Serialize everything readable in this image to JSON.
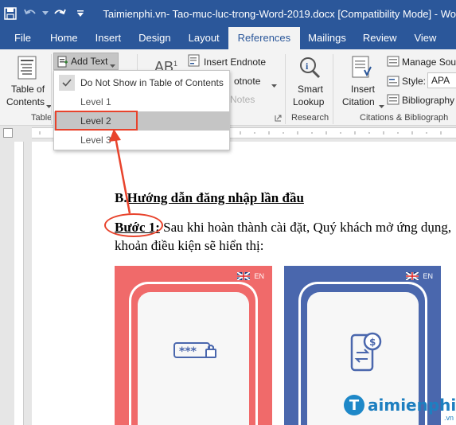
{
  "titlebar": {
    "title": "Taimienphi.vn- Tao-muc-luc-trong-Word-2019.docx [Compatibility Mode] - Wo"
  },
  "tabs": [
    "File",
    "Home",
    "Insert",
    "Design",
    "Layout",
    "References",
    "Mailings",
    "Review",
    "View"
  ],
  "active_tab": "References",
  "ribbon": {
    "toc_label1": "Table of",
    "toc_label2": "Contents",
    "toc_group": "Table",
    "add_text": "Add Text",
    "insert_endnote": "Insert Endnote",
    "next_footnote": "otnote",
    "show_notes": "Notes",
    "smart_lookup1": "Smart",
    "smart_lookup2": "Lookup",
    "research_group": "Research",
    "insert_citation1": "Insert",
    "insert_citation2": "Citation",
    "manage_sources": "Manage Sour",
    "style_label": "Style:",
    "style_value": "APA",
    "bibliography": "Bibliography",
    "citations_group": "Citations & Bibliograph"
  },
  "dropdown": {
    "items": [
      "Do Not Show in Table of Contents",
      "Level 1",
      "Level 2",
      "Level 3"
    ],
    "checked_index": 0,
    "highlighted_index": 2
  },
  "document": {
    "heading_prefix": "B.",
    "heading_rest": "Hướng dẫn đăng nhập lần đầu",
    "step_label": "Bước 1:",
    "step_text": " Sau khi hoàn thành cài đặt, Quý khách mở ứng dụng,",
    "step_text2": "khoản điều kiện sẽ hiển thị:",
    "lang_code": "EN",
    "pin_text": "***"
  },
  "watermark": {
    "letter": "T",
    "text": "aimienphi",
    "sub": ".vn"
  },
  "colors": {
    "word_blue": "#2b579a",
    "annotation_red": "#e8432c",
    "card_red": "#f06a6a",
    "card_blue": "#4a67ad"
  }
}
